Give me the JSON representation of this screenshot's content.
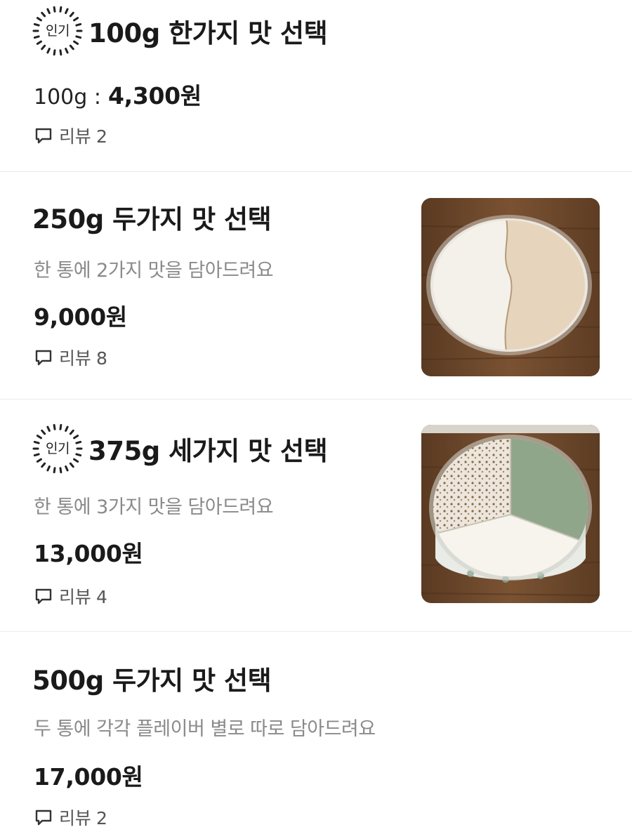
{
  "menu": {
    "items": [
      {
        "popular_badge": "인기",
        "title": "100g 한가지 맛 선택",
        "price_prefix": "100g :",
        "price": "4,300원",
        "review_label": "리뷰 2"
      },
      {
        "title": "250g 두가지 맛 선택",
        "description": "한 통에 2가지 맛을 담아드려요",
        "price": "9,000원",
        "review_label": "리뷰 8",
        "image": "two-flavor-ice-cream-tub"
      },
      {
        "popular_badge": "인기",
        "title": "375g 세가지 맛 선택",
        "description": "한 통에 3가지 맛을 담아드려요",
        "price": "13,000원",
        "review_label": "리뷰 4",
        "image": "three-flavor-ice-cream-tub"
      },
      {
        "title": "500g 두가지 맛 선택",
        "description": "두 통에 각각 플레이버 별로 따로 담아드려요",
        "price": "17,000원",
        "review_label": "리뷰 2"
      }
    ]
  },
  "icons": {
    "popular_badge": "sunburst-badge-icon",
    "review": "speech-bubble-icon"
  },
  "colors": {
    "text_primary": "#1a1a1a",
    "text_secondary": "#8a8a8a",
    "divider": "#ececec",
    "background": "#ffffff"
  }
}
